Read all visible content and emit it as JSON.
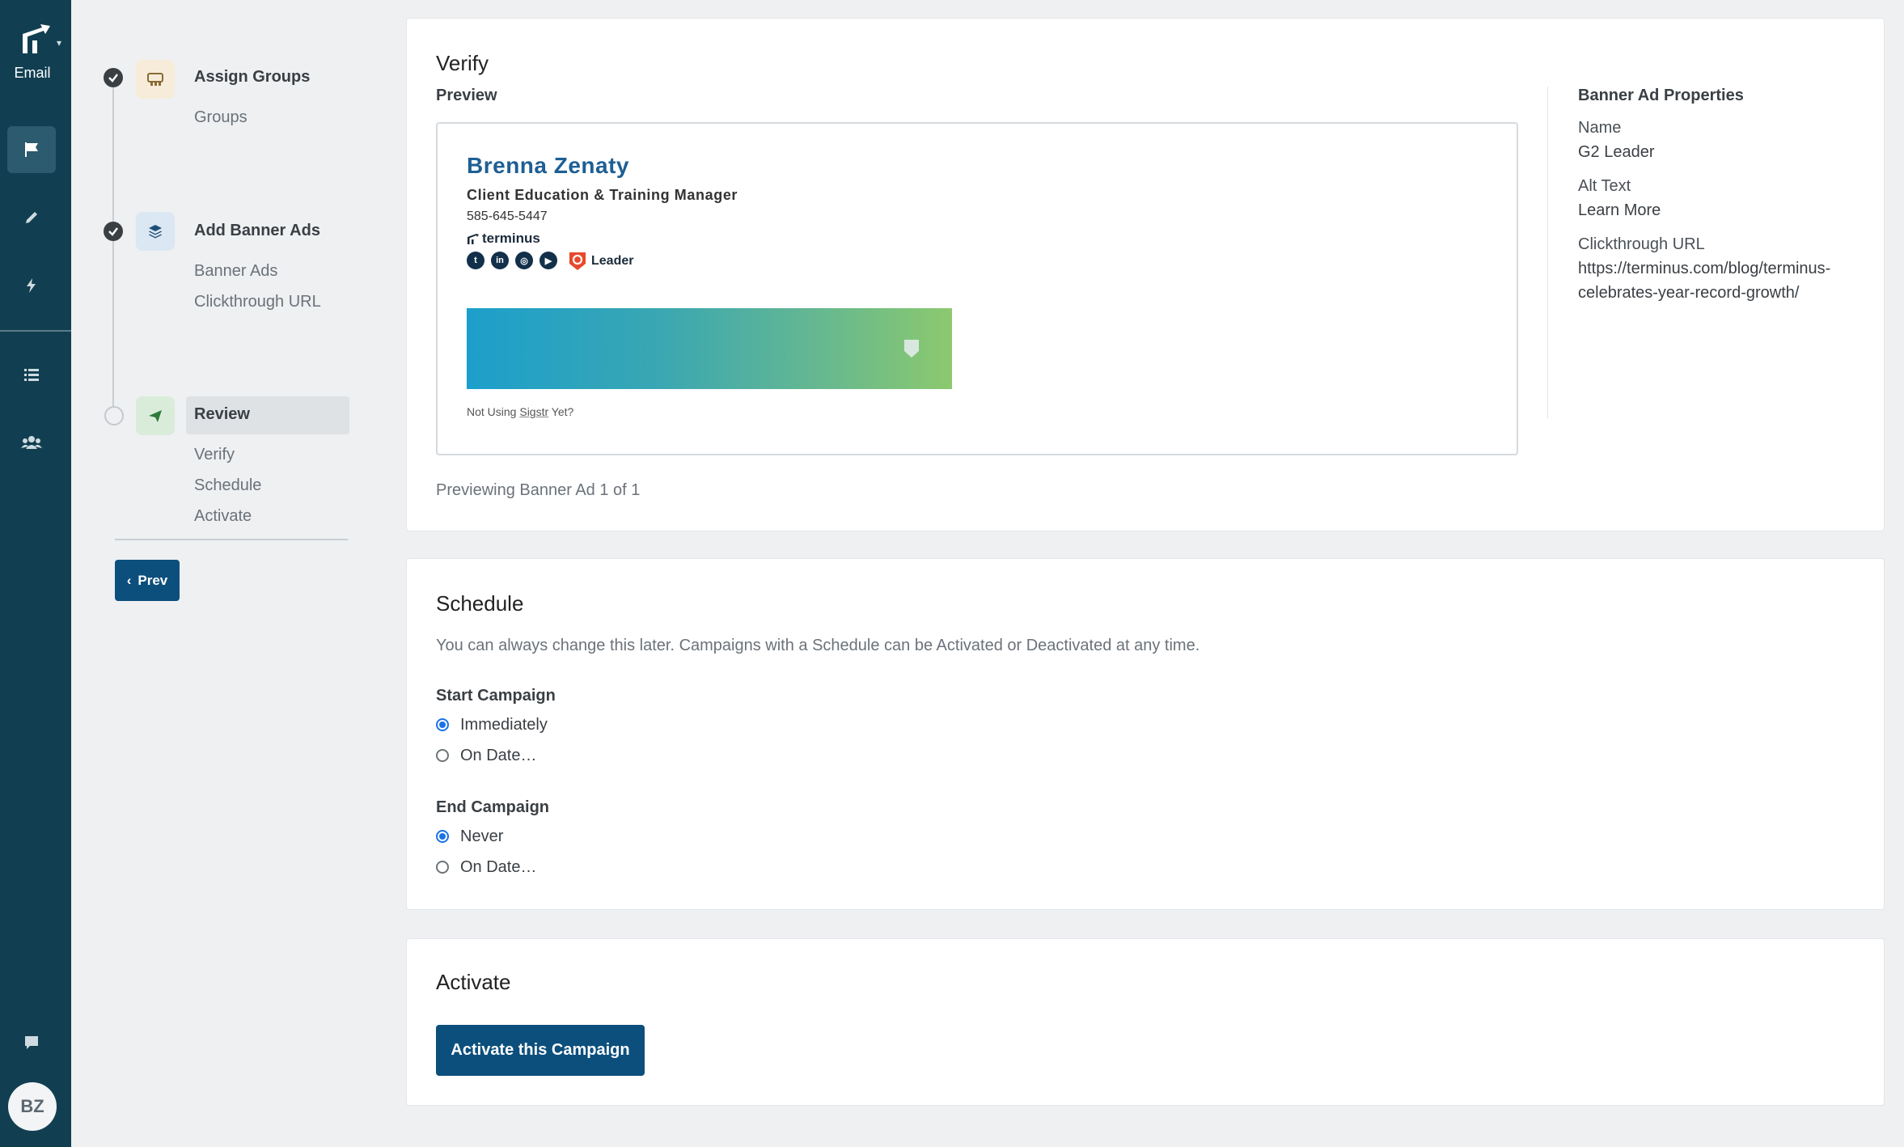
{
  "rail": {
    "app_label": "Email",
    "avatar_initials": "BZ",
    "nav_items": [
      "flag-icon",
      "pencil-icon",
      "bolt-icon",
      "list-icon",
      "users-icon",
      "chat-icon"
    ]
  },
  "stepper": {
    "steps": [
      {
        "title": "Assign Groups",
        "status": "complete",
        "subs": [
          "Groups"
        ]
      },
      {
        "title": "Add Banner Ads",
        "status": "complete",
        "subs": [
          "Banner Ads",
          "Clickthrough URL"
        ]
      },
      {
        "title": "Review",
        "status": "current",
        "subs": [
          "Verify",
          "Schedule",
          "Activate"
        ]
      }
    ],
    "prev_label": "Prev"
  },
  "verify": {
    "title": "Verify",
    "preview_label": "Preview",
    "signature": {
      "name": "Brenna Zenaty",
      "job_title": "Client Education & Training Manager",
      "phone": "585-645-5447",
      "brand": "terminus",
      "g2_label": "Leader",
      "footer_prefix": "Not Using",
      "footer_link": "Sigstr",
      "footer_suffix": "Yet?"
    },
    "previewing_text": "Previewing Banner Ad 1 of 1",
    "properties": {
      "heading": "Banner Ad Properties",
      "name_label": "Name",
      "name_value": "G2 Leader",
      "alt_label": "Alt Text",
      "alt_value": "Learn More",
      "url_label": "Clickthrough URL",
      "url_line1": "https://terminus.com/blog/terminus-",
      "url_line2": "celebrates-year-record-growth/"
    }
  },
  "schedule": {
    "title": "Schedule",
    "description": "You can always change this later. Campaigns with a Schedule can be Activated or Deactivated at any time.",
    "start_label": "Start Campaign",
    "start_options": [
      "Immediately",
      "On Date…"
    ],
    "start_selected": "Immediately",
    "end_label": "End Campaign",
    "end_options": [
      "Never",
      "On Date…"
    ],
    "end_selected": "Never"
  },
  "activate": {
    "title": "Activate",
    "button_label": "Activate this Campaign"
  },
  "colors": {
    "rail": "#113f51",
    "primary_button": "#0c4f7c",
    "name_blue": "#1e5f94",
    "radio_selected": "#1a73e8"
  }
}
